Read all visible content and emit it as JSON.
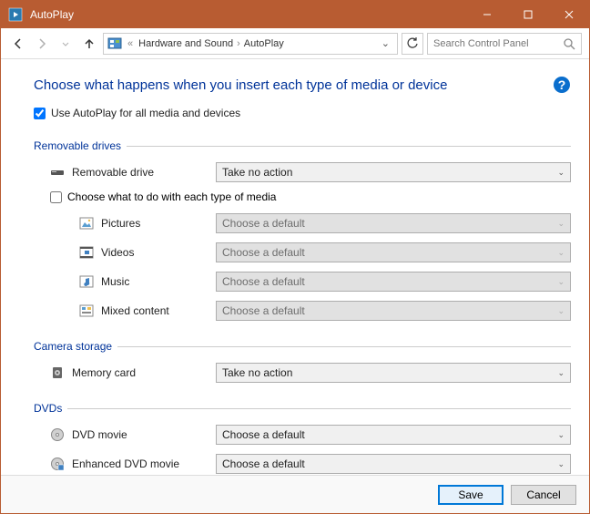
{
  "titlebar": {
    "title": "AutoPlay"
  },
  "nav": {
    "crumb1": "Hardware and Sound",
    "crumb2": "AutoPlay",
    "search_placeholder": "Search Control Panel"
  },
  "heading": "Choose what happens when you insert each type of media or device",
  "use_autoplay": "Use AutoPlay for all media and devices",
  "groups": {
    "removable": {
      "title": "Removable drives",
      "drive_label": "Removable drive",
      "drive_value": "Take no action",
      "each_type": "Choose what to do with each type of media",
      "items": {
        "pictures": {
          "label": "Pictures",
          "value": "Choose a default"
        },
        "videos": {
          "label": "Videos",
          "value": "Choose a default"
        },
        "music": {
          "label": "Music",
          "value": "Choose a default"
        },
        "mixed": {
          "label": "Mixed content",
          "value": "Choose a default"
        }
      }
    },
    "camera": {
      "title": "Camera storage",
      "memory_label": "Memory card",
      "memory_value": "Take no action"
    },
    "dvds": {
      "title": "DVDs",
      "dvd_label": "DVD movie",
      "dvd_value": "Choose a default",
      "enhanced_label": "Enhanced DVD movie",
      "enhanced_value": "Choose a default"
    }
  },
  "footer": {
    "save": "Save",
    "cancel": "Cancel"
  }
}
